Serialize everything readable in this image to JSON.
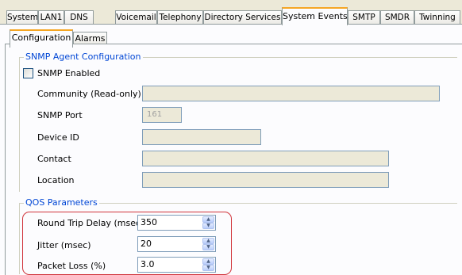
{
  "tabs": [
    "System",
    "LAN1",
    "DNS",
    "Voicemail",
    "Telephony",
    "Directory Services",
    "System Events",
    "SMTP",
    "SMDR",
    "Twinning"
  ],
  "active_tab": "System Events",
  "subtabs": [
    "Configuration",
    "Alarms"
  ],
  "active_subtab": "Configuration",
  "snmp": {
    "legend": "SNMP Agent Configuration",
    "enabled_label": "SNMP Enabled",
    "enabled": false,
    "community_label": "Community (Read-only)",
    "community_value": "",
    "port_label": "SNMP Port",
    "port_value": "161",
    "device_id_label": "Device ID",
    "device_id_value": "",
    "contact_label": "Contact",
    "contact_value": "",
    "location_label": "Location",
    "location_value": ""
  },
  "qos": {
    "legend": "QOS Parameters",
    "rtd_label": "Round Trip Delay (msec)",
    "rtd_value": "350",
    "jitter_label": "Jitter (msec)",
    "jitter_value": "20",
    "loss_label": "Packet Loss (%)",
    "loss_value": "3.0"
  },
  "colors": {
    "active_tab_accent": "#f5a623",
    "legend_text": "#0046d5",
    "highlight": "#d0333a"
  }
}
